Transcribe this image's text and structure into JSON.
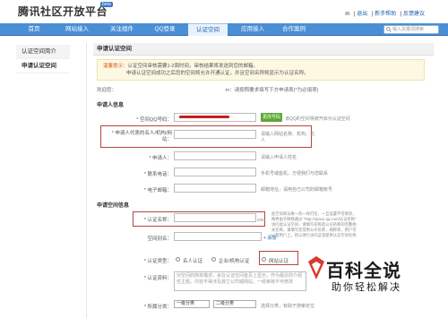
{
  "header": {
    "logo": "腾讯社区开放平台",
    "beta": "beta",
    "user": "m",
    "links": [
      "退出",
      "新手帮助",
      "反馈建议"
    ],
    "separator": "|"
  },
  "nav": {
    "items": [
      "首页",
      "网站接入",
      "关注组件",
      "QQ登录",
      "认证空间",
      "应用接入",
      "合作案例"
    ],
    "active": "认证空间",
    "search_placeholder": "输入关键词搜索"
  },
  "sidebar": {
    "items": [
      "认证空间简介",
      "申请认证空间"
    ]
  },
  "main": {
    "title": "申请认证空间",
    "notice_label": "温馨提示：",
    "notice_line1": "认证空间审核需要1-2周时间，审核结果将发送到您的邮箱。",
    "notice_line2": "申请认证空间成功之后您的空间将允许开通认证，并且空间名称将显示为认证名称。",
    "welcome_prefix": "欢迎您：",
    "welcome_user": "m",
    "welcome_tip": "：请按照要求填写下方申请表(*为必填项)",
    "applicant_section": "申请人信息",
    "qq_label": "* 空间QQ号码：",
    "qq_button": "更改号码",
    "qq_hint": "该QQ的空间将被开启为认证空间",
    "rep_label": "* 申请人代表的名人/机构/网站：",
    "rep_hint": "请输入网站名称、机构、名人",
    "applicant_label": "* 申请人：",
    "applicant_hint": "请输入申请人姓名",
    "phone_label": "* 联系电话：",
    "phone_hint": "手机号或座机，方便我们与您联系",
    "email_label": "* 电子邮箱：",
    "email_hint": "邮箱地址，请用自己公司的邮箱帐号",
    "space_section": "申请空间信息",
    "cert_name_label": "* 认证名称：",
    "cert_counter": "0/50",
    "cert_hint": "此空间将与唯一的一样打名，一旦设置不可修改，两件由于网络通过 \"http://space.qq.com/认证名称\" 访问此认证空间，请填写名称及公司名称的完整相关名称，请填写您常用公众名称，两称等，用户可以使用户上，的以进行访问这里提供认证空间名称",
    "space_alias_label": "空间别名：",
    "add_link": "+ 添加",
    "type_label": "* 认证类型：",
    "type_options": [
      "名人认证",
      "企业/机构认证",
      "网站认证"
    ],
    "data_label": "* 认证资料：",
    "data_placeholder": "对空间的简单描述，会在认证空间首页上显示，作为最近的介绍性主题，内容不得涉及其它公司或网站，一经审核不可修改",
    "category_label": "* 所属分类：",
    "category_1": "一级分类",
    "category_2": "二级分类",
    "category_hint": "选择分类，有助于搜索定位"
  },
  "watermark": {
    "logo": "百科全说",
    "sub": "助你轻松解决"
  },
  "colors": {
    "nav": "#4a8ed6",
    "accent": "#c81e1e",
    "notice_bg": "#fdf8e4",
    "button": "#5aa833"
  }
}
